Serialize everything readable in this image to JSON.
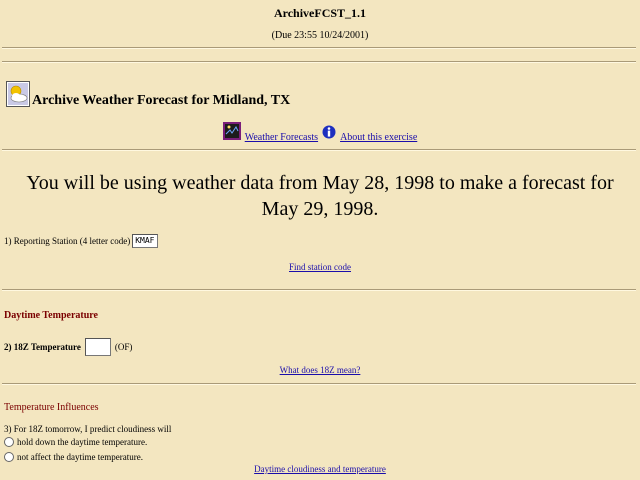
{
  "header": {
    "title": "ArchiveFCST_1.1",
    "due": "(Due 23:55 10/24/2001)"
  },
  "main": {
    "heading": "Archive Weather Forecast for Midland, TX",
    "weather_forecasts_link": "Weather Forecasts",
    "about_link": "About this exercise",
    "note": "You will be using weather data from May 28, 1998 to make a forecast for May 29, 1998."
  },
  "q1": {
    "label": "1) Reporting Station (4 letter code)",
    "value": "KMAF",
    "find_link": "Find station code"
  },
  "daytime": {
    "section_title": "Daytime Temperature",
    "q2_label": "2) 18Z Temperature",
    "q2_value": "",
    "q2_unit": "(OF)",
    "what_link": "What does 18Z mean?"
  },
  "influences": {
    "section_title": "Temperature Influences",
    "q3_label": "3) For 18Z tomorrow, I predict cloudiness will",
    "options": [
      "hold down the daytime temperature.",
      "not affect the daytime temperature."
    ],
    "link": "Daytime cloudiness and temperature"
  },
  "colors": {
    "background": "#f3e6c0",
    "section_title": "#7a0000",
    "link": "#1a0dab"
  },
  "icons": {
    "weather": "sun-cloud-icon",
    "forecast": "satellite-image-icon",
    "info": "info-icon"
  }
}
